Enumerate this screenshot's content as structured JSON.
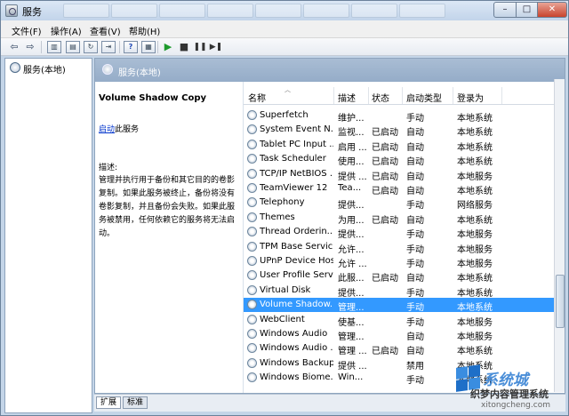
{
  "window": {
    "title": "服务",
    "min_glyph": "–",
    "max_glyph": "□",
    "close_glyph": "✕"
  },
  "menu": [
    "文件(F)",
    "操作(A)",
    "查看(V)",
    "帮助(H)"
  ],
  "toolbar": {
    "back_glyph": "⇦",
    "forward_glyph": "⇨",
    "play_glyph": "▶",
    "stop_glyph": "■",
    "pause_glyph": "❚❚",
    "restart_glyph": "▶❚"
  },
  "tree": {
    "root": "服务(本地)"
  },
  "main": {
    "header_title": "服务(本地)",
    "selected_service": "Volume Shadow Copy",
    "start_link": "启动",
    "start_suffix": "此服务",
    "desc_label": "描述:",
    "desc_text": "管理并执行用于备份和其它目的的卷影复制。如果此服务被终止，备份将没有卷影复制，并且备份会失败。如果此服务被禁用，任何依赖它的服务将无法启动。"
  },
  "columns": {
    "name": "名称",
    "desc": "描述",
    "status": "状态",
    "startup": "启动类型",
    "logon": "登录为"
  },
  "services": [
    {
      "name": "Superfetch",
      "desc": "维护...",
      "status": "",
      "startup": "手动",
      "logon": "本地系统"
    },
    {
      "name": "System Event N...",
      "desc": "监视...",
      "status": "已启动",
      "startup": "自动",
      "logon": "本地系统"
    },
    {
      "name": "Tablet PC Input ...",
      "desc": "启用 ...",
      "status": "已启动",
      "startup": "自动",
      "logon": "本地系统"
    },
    {
      "name": "Task Scheduler",
      "desc": "使用...",
      "status": "已启动",
      "startup": "自动",
      "logon": "本地系统"
    },
    {
      "name": "TCP/IP NetBIOS ...",
      "desc": "提供 ...",
      "status": "已启动",
      "startup": "自动",
      "logon": "本地服务"
    },
    {
      "name": "TeamViewer 12",
      "desc": "Tea...",
      "status": "已启动",
      "startup": "自动",
      "logon": "本地系统"
    },
    {
      "name": "Telephony",
      "desc": "提供...",
      "status": "",
      "startup": "手动",
      "logon": "网络服务"
    },
    {
      "name": "Themes",
      "desc": "为用...",
      "status": "已启动",
      "startup": "自动",
      "logon": "本地系统"
    },
    {
      "name": "Thread Orderin...",
      "desc": "提供...",
      "status": "",
      "startup": "手动",
      "logon": "本地服务"
    },
    {
      "name": "TPM Base Servic...",
      "desc": "允许...",
      "status": "",
      "startup": "手动",
      "logon": "本地服务"
    },
    {
      "name": "UPnP Device Host",
      "desc": "允许 ...",
      "status": "",
      "startup": "手动",
      "logon": "本地服务"
    },
    {
      "name": "User Profile Serv...",
      "desc": "此服...",
      "status": "已启动",
      "startup": "自动",
      "logon": "本地系统"
    },
    {
      "name": "Virtual Disk",
      "desc": "提供...",
      "status": "",
      "startup": "手动",
      "logon": "本地系统"
    },
    {
      "name": "Volume Shadow...",
      "desc": "管理...",
      "status": "",
      "startup": "手动",
      "logon": "本地系统"
    },
    {
      "name": "WebClient",
      "desc": "使基...",
      "status": "",
      "startup": "手动",
      "logon": "本地服务"
    },
    {
      "name": "Windows Audio",
      "desc": "管理...",
      "status": "",
      "startup": "自动",
      "logon": "本地服务"
    },
    {
      "name": "Windows Audio ...",
      "desc": "管理 ...",
      "status": "已启动",
      "startup": "自动",
      "logon": "本地系统"
    },
    {
      "name": "Windows Backup",
      "desc": "提供 ...",
      "status": "",
      "startup": "禁用",
      "logon": "本地系统"
    },
    {
      "name": "Windows Biome...",
      "desc": "Win...",
      "status": "",
      "startup": "手动",
      "logon": "本地系统"
    }
  ],
  "selected_index": 13,
  "bottom_tabs": [
    "扩展",
    "标准"
  ],
  "watermark": {
    "title": "系统城",
    "subtitle": "织梦内容管理系统",
    "url": "xitongcheng.com"
  },
  "colors": {
    "selection": "#3399ff",
    "link": "#0033cc",
    "header": "#a9bdd4"
  }
}
